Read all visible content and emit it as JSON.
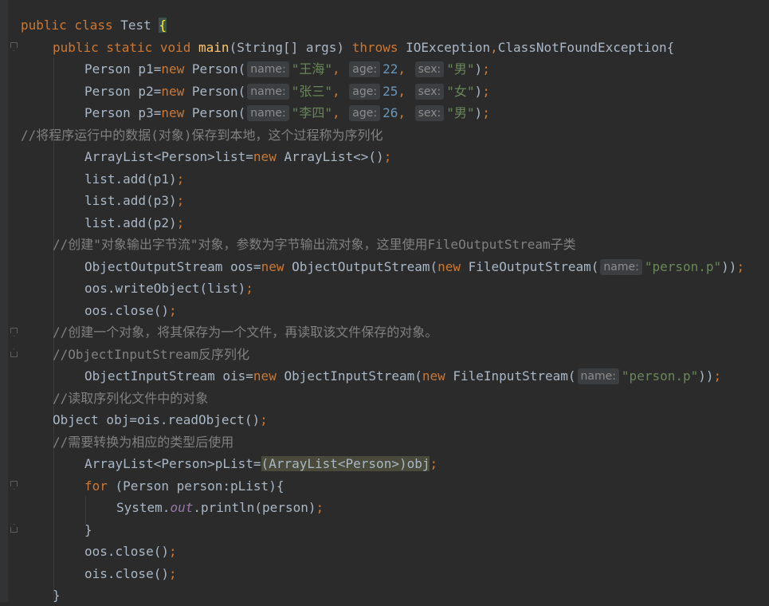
{
  "code": {
    "l1": {
      "a": "public class ",
      "b": "Test ",
      "c": "{"
    },
    "l2": {
      "a": "public static void ",
      "b": "main",
      "c": "(String[] args) ",
      "d": "throws ",
      "e": "IOException",
      ",": ",",
      "f": "ClassNotFoundException{"
    },
    "l3": {
      "a": "Person p1=",
      "new": "new ",
      "b": "Person(",
      "hint1": "name:",
      "s1": "\"王海\"",
      "c1": ", ",
      "hint2": "age:",
      "n": "22",
      "c2": ", ",
      "hint3": "sex:",
      "s2": "\"男\"",
      "e": ")",
      ";": ";"
    },
    "l4": {
      "a": "Person p2=",
      "new": "new ",
      "b": "Person(",
      "hint1": "name:",
      "s1": "\"张三\"",
      "c1": ", ",
      "hint2": "age:",
      "n": "25",
      "c2": ", ",
      "hint3": "sex:",
      "s2": "\"女\"",
      "e": ")",
      ";": ";"
    },
    "l5": {
      "a": "Person p3=",
      "new": "new ",
      "b": "Person(",
      "hint1": "name:",
      "s1": "\"李四\"",
      "c1": ", ",
      "hint2": "age:",
      "n": "26",
      "c2": ", ",
      "hint3": "sex:",
      "s2": "\"男\"",
      "e": ")",
      ";": ";"
    },
    "l6": "//将程序运行中的数据(对象)保存到本地，这个过程称为序列化",
    "l7": {
      "a": "ArrayList<Person>list=",
      "new": "new ",
      "b": "ArrayList<>()",
      ";": ";"
    },
    "l8": {
      "a": "list.add(p1)",
      ";": ";"
    },
    "l9": {
      "a": "list.add(p3)",
      ";": ";"
    },
    "l10": {
      "a": "list.add(p2)",
      ";": ";"
    },
    "l11": "//创建\"对象输出字节流\"对象，参数为字节输出流对象，这里使用FileOutputStream子类",
    "l12": {
      "a": "ObjectOutputStream oos=",
      "new": "new ",
      "b": "ObjectOutputStream(",
      "new2": "new ",
      "c": "FileOutputStream(",
      "hint": "name:",
      "s": "\"person.p\"",
      "e": "))",
      ";": ";"
    },
    "l13": {
      "a": "oos.writeObject(list)",
      ";": ";"
    },
    "l14": {
      "a": "oos.close()",
      ";": ";"
    },
    "l15": "//创建一个对象，将其保存为一个文件，再读取该文件保存的对象。",
    "l16": "//ObjectInputStream反序列化",
    "l17": {
      "a": "ObjectInputStream ois=",
      "new": "new ",
      "b": "ObjectInputStream(",
      "new2": "new ",
      "c": "FileInputStream(",
      "hint": "name:",
      "s": "\"person.p\"",
      "e": "))",
      ";": ";"
    },
    "l18": "//读取序列化文件中的对象",
    "l19": {
      "a": "Object obj=ois.readObject()",
      ";": ";"
    },
    "l20": "//需要转换为相应的类型后使用",
    "l21": {
      "a": "ArrayList<Person>pList=",
      "sel": "(ArrayList<Person>)obj",
      ";": ";"
    },
    "l22": {
      "for": "for ",
      "a": "(Person person:pList){"
    },
    "l23": {
      "a": "System.",
      "out": "out",
      "b": ".println(person)",
      ";": ";"
    },
    "l24": "}",
    "l25": {
      "a": "oos.close()",
      ";": ";"
    },
    "l26": {
      "a": "ois.close()",
      ";": ";"
    },
    "l27": "}"
  }
}
